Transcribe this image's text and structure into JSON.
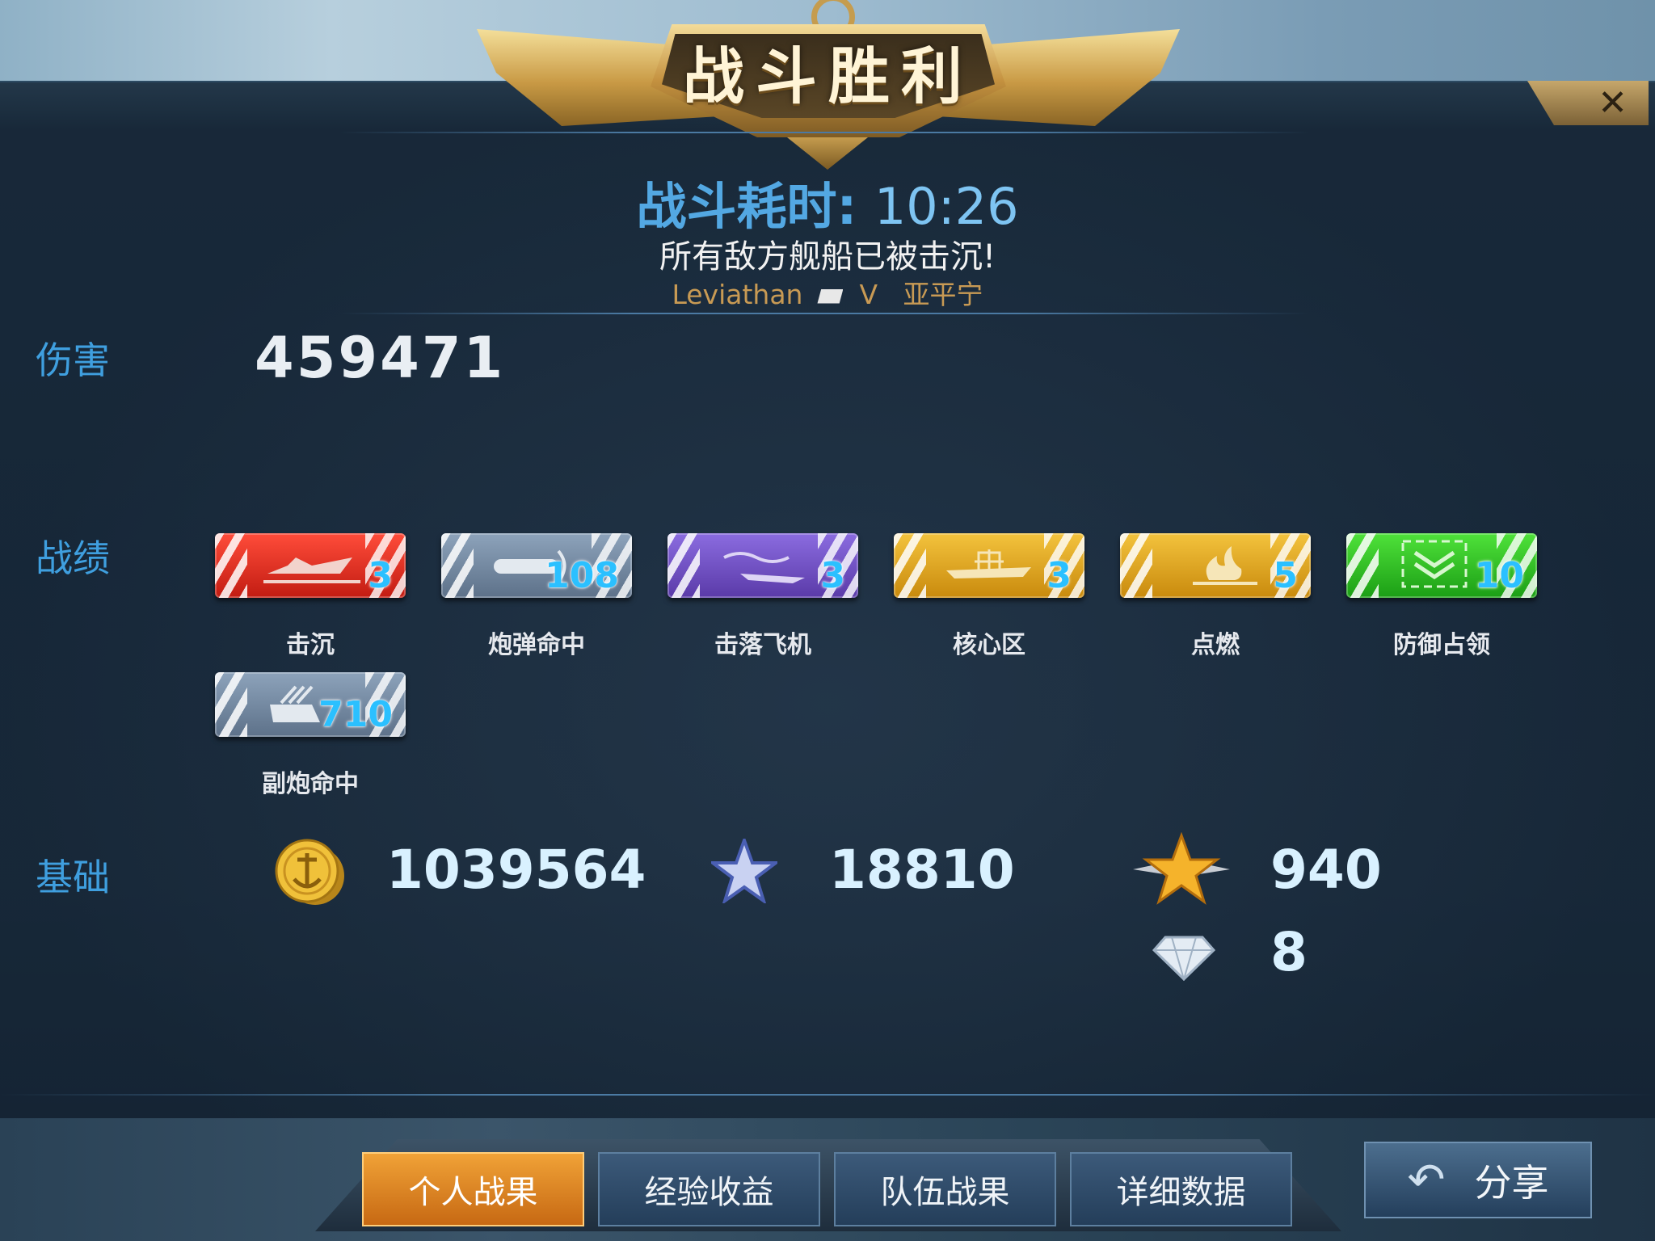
{
  "header": {
    "title": "战斗胜利"
  },
  "battle": {
    "time_label": "战斗耗时:",
    "time_value": "10:26",
    "result_message": "所有敌方舰船已被击沉!",
    "player_name": "Leviathan",
    "vs": "V",
    "opponent_name": "亚平宁"
  },
  "damage": {
    "label": "伤害",
    "value": "459471"
  },
  "record": {
    "label": "战绩",
    "badges": [
      {
        "label": "击沉",
        "count": "3",
        "icon": "sinking-ship-icon",
        "color": "#e0281a"
      },
      {
        "label": "炮弹命中",
        "count": "108",
        "icon": "shell-hit-icon",
        "color": "#7a8ea6"
      },
      {
        "label": "击落飞机",
        "count": "3",
        "icon": "plane-shot-down-icon",
        "color": "#6f4fc4"
      },
      {
        "label": "核心区",
        "count": "3",
        "icon": "core-zone-icon",
        "color": "#e0a522"
      },
      {
        "label": "点燃",
        "count": "5",
        "icon": "fire-icon",
        "color": "#e0a522"
      },
      {
        "label": "防御占领",
        "count": "10",
        "icon": "defend-capture-icon",
        "color": "#31c423"
      },
      {
        "label": "副炮命中",
        "count": "710",
        "icon": "secondary-gun-icon",
        "color": "#7a8ea6"
      }
    ]
  },
  "basic": {
    "label": "基础",
    "coins": "1039564",
    "experience": "18810",
    "rank_points": "940",
    "diamonds": "8"
  },
  "close_icon": "close-icon",
  "tabs": [
    {
      "label": "个人战果",
      "active": true
    },
    {
      "label": "经验收益",
      "active": false
    },
    {
      "label": "队伍战果",
      "active": false
    },
    {
      "label": "详细数据",
      "active": false
    }
  ],
  "share": {
    "label": "分享",
    "icon": "back-arrow-icon"
  }
}
